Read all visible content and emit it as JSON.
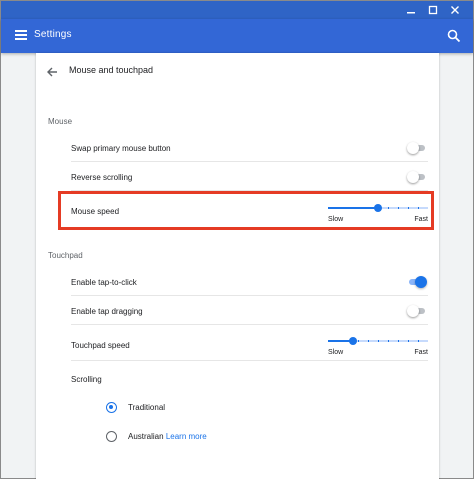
{
  "app": {
    "title": "Settings"
  },
  "page": {
    "title": "Mouse and touchpad"
  },
  "mouse": {
    "section_label": "Mouse",
    "swap_label": "Swap primary mouse button",
    "swap_on": false,
    "reverse_label": "Reverse scrolling",
    "reverse_on": false,
    "speed_label": "Mouse speed",
    "speed_value": 0.5,
    "slow_label": "Slow",
    "fast_label": "Fast"
  },
  "touchpad": {
    "section_label": "Touchpad",
    "tap_click_label": "Enable tap-to-click",
    "tap_click_on": true,
    "tap_drag_label": "Enable tap dragging",
    "tap_drag_on": false,
    "speed_label": "Touchpad speed",
    "speed_value": 0.25,
    "slow_label": "Slow",
    "fast_label": "Fast",
    "scrolling_label": "Scrolling",
    "scroll_options": [
      {
        "label": "Traditional",
        "selected": true
      },
      {
        "label": "Australian",
        "selected": false,
        "link": "Learn more"
      }
    ]
  },
  "colors": {
    "titlebar": "#2f64c6",
    "appbar": "#3367d6",
    "accent": "#1a73e8",
    "highlight": "#e53b24"
  }
}
